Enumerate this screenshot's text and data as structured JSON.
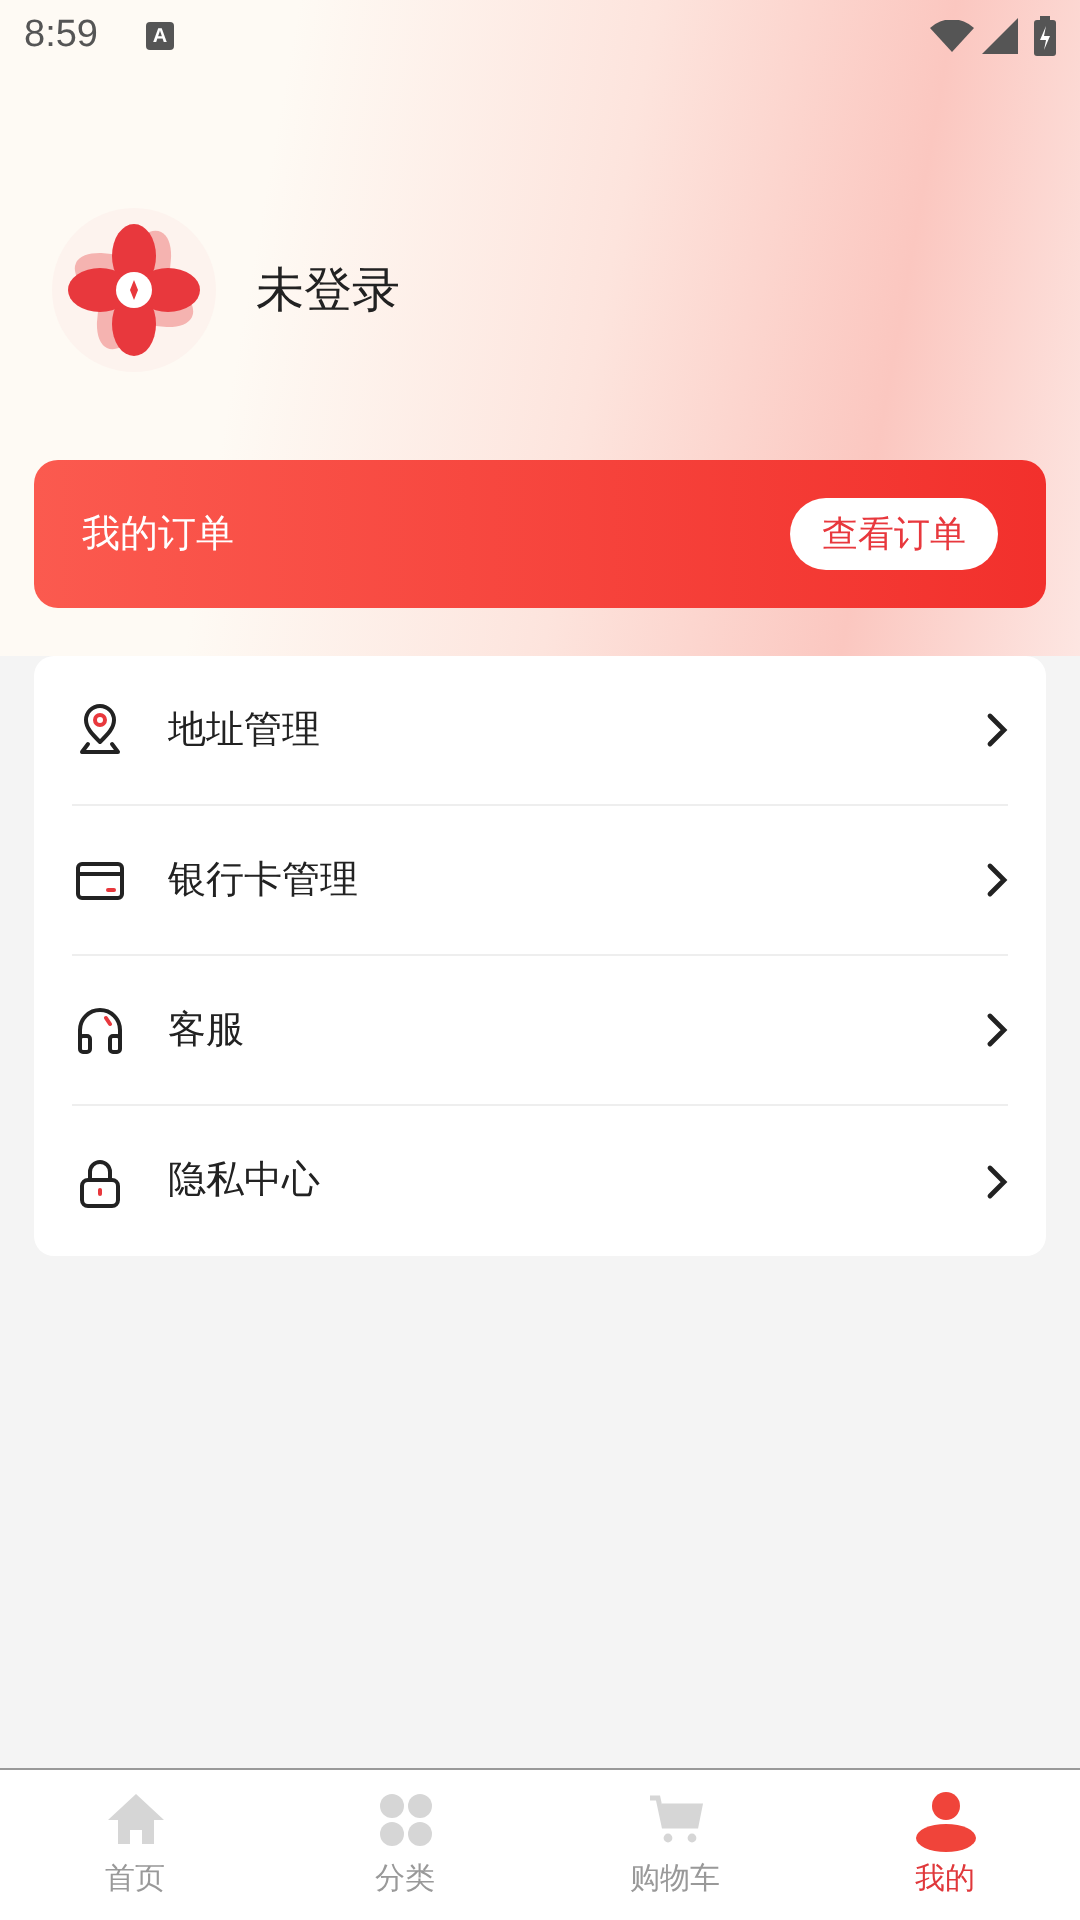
{
  "status_bar": {
    "time": "8:59",
    "notification_badge": "A"
  },
  "profile": {
    "name": "未登录"
  },
  "order_banner": {
    "title": "我的订单",
    "button": "查看订单"
  },
  "menu": [
    {
      "kind": "address",
      "label": "地址管理"
    },
    {
      "kind": "card",
      "label": "银行卡管理"
    },
    {
      "kind": "service",
      "label": "客服"
    },
    {
      "kind": "privacy",
      "label": "隐私中心"
    }
  ],
  "tabs": [
    {
      "kind": "home",
      "label": "首页",
      "selected": false
    },
    {
      "kind": "category",
      "label": "分类",
      "selected": false
    },
    {
      "kind": "cart",
      "label": "购物车",
      "selected": false
    },
    {
      "kind": "me",
      "label": "我的",
      "selected": true
    }
  ]
}
